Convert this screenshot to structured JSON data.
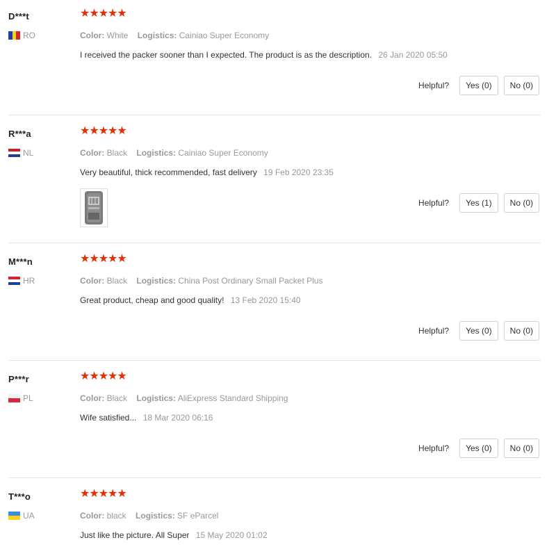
{
  "labels": {
    "color": "Color:",
    "logistics": "Logistics:",
    "helpful": "Helpful?"
  },
  "colors": {
    "star": "#e62e04",
    "muted": "#999999"
  },
  "reviews": [
    {
      "name": "D***t",
      "country": "RO",
      "rating": 5,
      "stars": "★★★★★",
      "color": "White",
      "logistics": "Cainiao Super Economy",
      "text": "I received the packer sooner than I expected. The product is as the description.",
      "date": "26 Jan 2020 05:50",
      "yes": "Yes (0)",
      "no": "No (0)"
    },
    {
      "name": "R***a",
      "country": "NL",
      "rating": 5,
      "stars": "★★★★★",
      "color": "Black",
      "logistics": "Cainiao Super Economy",
      "text": "Very beautiful, thick recommended, fast delivery",
      "date": "19 Feb 2020 23:35",
      "yes": "Yes (1)",
      "no": "No (0)"
    },
    {
      "name": "M***n",
      "country": "HR",
      "rating": 5,
      "stars": "★★★★★",
      "color": "Black",
      "logistics": "China Post Ordinary Small Packet Plus",
      "text": "Great product, cheap and good quality!",
      "date": "13 Feb 2020 15:40",
      "yes": "Yes (0)",
      "no": "No (0)"
    },
    {
      "name": "P***r",
      "country": "PL",
      "rating": 5,
      "stars": "★★★★★",
      "color": "Black",
      "logistics": "AliExpress Standard Shipping",
      "text": "Wife satisfied...",
      "date": "18 Mar 2020 06:16",
      "yes": "Yes (0)",
      "no": "No (0)"
    },
    {
      "name": "T***o",
      "country": "UA",
      "rating": 5,
      "stars": "★★★★★",
      "color": "black",
      "logistics": "SF eParcel",
      "text": "Just like the picture. All Super",
      "date": "15 May 2020 01:02"
    }
  ]
}
